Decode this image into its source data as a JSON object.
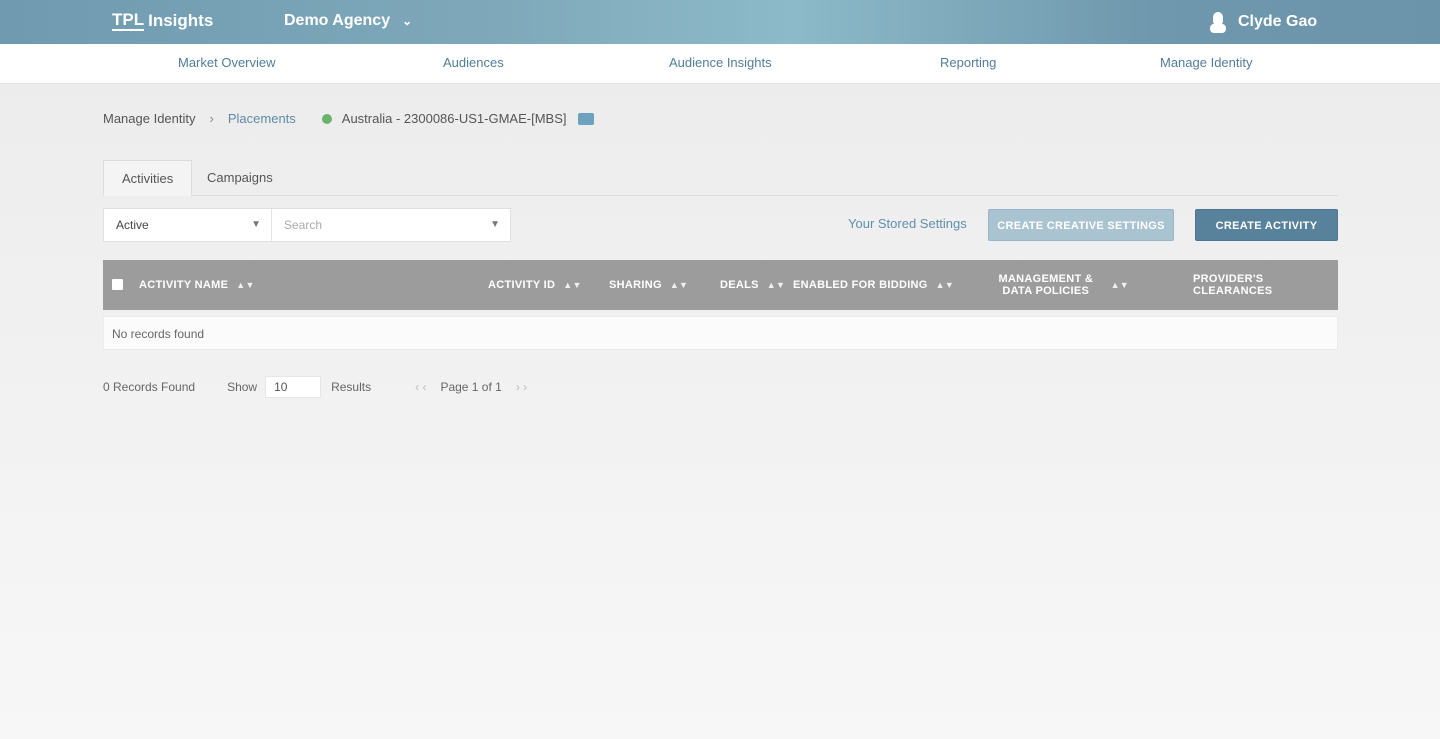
{
  "header": {
    "logo_mark": "TPL",
    "logo_text": "Insights",
    "agency": "Demo Agency",
    "user_name": "Clyde Gao"
  },
  "nav": {
    "items": [
      "Market Overview",
      "Audiences",
      "Audience Insights",
      "Reporting",
      "Manage Identity"
    ]
  },
  "breadcrumb": {
    "root": "Manage Identity",
    "separator": "›",
    "link": "Placements",
    "account": "Australia - 2300086-US1-GMAE-[MBS]"
  },
  "tabs": [
    "Activities",
    "Campaigns"
  ],
  "filters": {
    "status_value": "Active",
    "search_placeholder": "Search"
  },
  "toolbar": {
    "settings_link": "Your Stored Settings",
    "secondary_button": "CREATE CREATIVE SETTINGS",
    "primary_button": "CREATE ACTIVITY"
  },
  "table": {
    "columns": [
      "ACTIVITY NAME",
      "ACTIVITY ID",
      "SHARING",
      "DEALS",
      "ENABLED FOR BIDDING",
      "MANAGEMENT & DATA POLICIES",
      "PROVIDER'S CLEARANCES"
    ],
    "empty_message": "No records found"
  },
  "pagination": {
    "count_text": "0 Records Found",
    "show_label": "Show",
    "page_size": "10",
    "results_label": "Results",
    "prev": "‹ ‹",
    "page_text": "Page 1 of 1",
    "next": "› ›"
  },
  "colors": {
    "topbar_start": "#6f9ab0",
    "topbar_mid": "#8cbac8",
    "link": "#5f8fae",
    "primary_button": "#58819c",
    "table_header": "#9c9c9c",
    "status_active": "#6bb36a"
  }
}
